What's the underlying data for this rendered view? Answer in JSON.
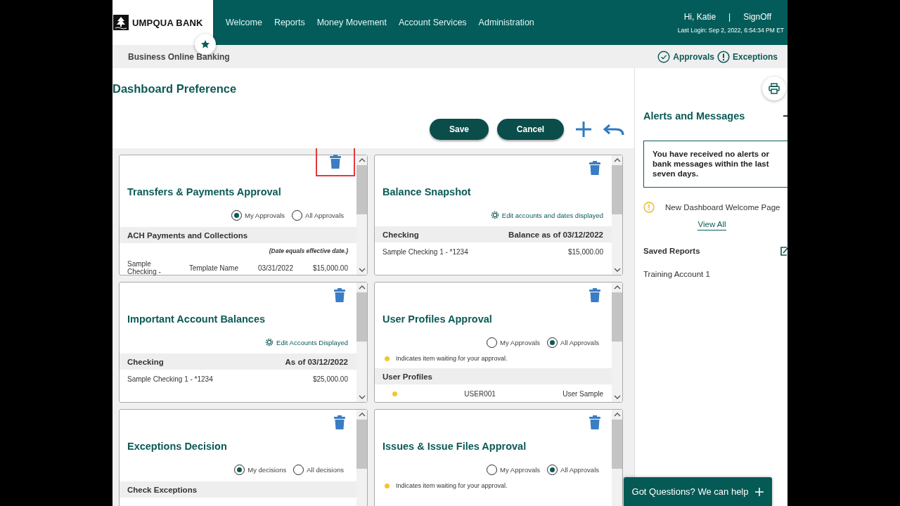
{
  "header": {
    "logo": "UMPQUA BANK",
    "nav": [
      "Welcome",
      "Reports",
      "Money Movement",
      "Account Services",
      "Administration"
    ],
    "greeting": "Hi, Katie",
    "separator": "|",
    "signoff": "SignOff",
    "last_login": "Last Login: Sep 2, 2022, 6:54:34 PM ET"
  },
  "subbar": {
    "title": "Business Online Banking",
    "links": [
      {
        "label": "Approvals",
        "kind": "check"
      },
      {
        "label": "Exceptions",
        "kind": "alert"
      }
    ]
  },
  "page": {
    "title": "Dashboard Preference",
    "buttons": [
      "Save",
      "Cancel"
    ]
  },
  "widgets": [
    {
      "title": "Transfers & Payments Approval",
      "highlighted": true,
      "radios": [
        {
          "label": "My Approvals",
          "selected": true
        },
        {
          "label": "All Approvals",
          "selected": false
        }
      ],
      "table": {
        "header": [
          "ACH Payments and Collections"
        ],
        "note": "(Date equals effective date.)",
        "rows": [
          {
            "cells": [
              "Sample Checking -",
              "Template Name",
              "03/31/2022",
              "$15,000.00"
            ]
          }
        ]
      }
    },
    {
      "title": "Balance Snapshot",
      "highlighted": false,
      "edit_link": "Edit accounts and dates displayed",
      "table": {
        "header": [
          "Checking",
          "Balance as of 03/12/2022"
        ],
        "rows": [
          {
            "cells": [
              "Sample Checking 1 - *1234",
              "$15,000.00"
            ]
          }
        ]
      }
    },
    {
      "title": "Important Account Balances",
      "highlighted": false,
      "edit_link": "Edit Accounts Displayed",
      "table": {
        "header": [
          "Checking",
          "As of 03/12/2022"
        ],
        "rows": [
          {
            "cells": [
              "Sample Checking 1 - *1234",
              "$25,000.00"
            ]
          }
        ]
      }
    },
    {
      "title": "User Profiles Approval",
      "highlighted": false,
      "radios": [
        {
          "label": "My Approvals",
          "selected": false
        },
        {
          "label": "All Approvals",
          "selected": true
        }
      ],
      "legend": "Indicates item waiting for your approval.",
      "table": {
        "header": [
          "User Profiles"
        ],
        "rows": [
          {
            "pending": true,
            "cells": [
              "USER001",
              "User Sample"
            ]
          }
        ]
      }
    },
    {
      "title": "Exceptions Decision",
      "highlighted": false,
      "radios": [
        {
          "label": "My decisions",
          "selected": true
        },
        {
          "label": "All decisions",
          "selected": false
        }
      ],
      "table": {
        "header": [
          "Check Exceptions"
        ]
      }
    },
    {
      "title": "Issues & Issue Files Approval",
      "highlighted": false,
      "radios": [
        {
          "label": "My Approvals",
          "selected": false
        },
        {
          "label": "All Approvals",
          "selected": true
        }
      ],
      "legend": "Indicates item waiting for your approval."
    }
  ],
  "sidebar": {
    "title": "Alerts and Messages",
    "message": "You have received no alerts or bank messages within the last seven days.",
    "notice": "New Dashboard Welcome Page",
    "view_all": "View All",
    "saved_reports_title": "Saved Reports",
    "saved_reports": [
      "Training Account 1"
    ]
  },
  "help_button": {
    "label": "Got Questions? We can help"
  }
}
